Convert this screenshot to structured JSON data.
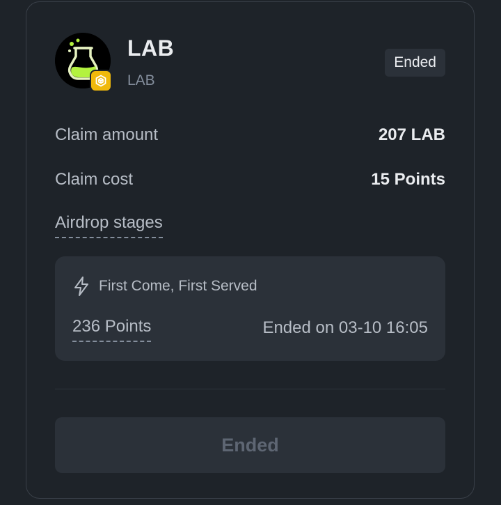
{
  "token": {
    "name": "LAB",
    "symbol": "LAB",
    "status": "Ended",
    "logo_icon": "flask-icon",
    "chain_icon": "bnb-chain-icon"
  },
  "details": {
    "claim_amount_label": "Claim amount",
    "claim_amount_value": "207 LAB",
    "claim_cost_label": "Claim cost",
    "claim_cost_value": "15 Points"
  },
  "stages": {
    "label": "Airdrop stages",
    "items": [
      {
        "icon": "lightning-icon",
        "type": "First Come, First Served",
        "points": "236 Points",
        "end_text": "Ended on 03-10 16:05"
      }
    ]
  },
  "action": {
    "button_label": "Ended"
  },
  "colors": {
    "background": "#1e2329",
    "panel": "#2b3139",
    "text_primary": "#eaecef",
    "text_secondary": "#b7bdc6",
    "text_muted": "#848e9c",
    "bnb_yellow": "#f0b90b",
    "logo_green": "#b3f23f"
  }
}
